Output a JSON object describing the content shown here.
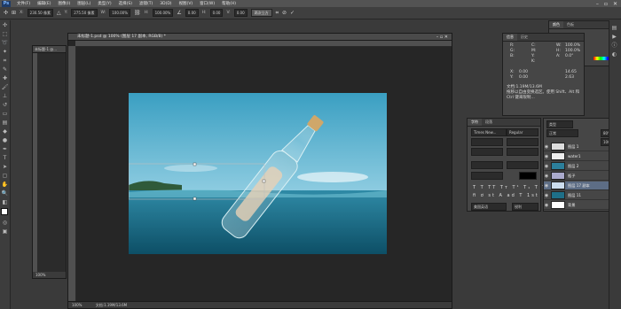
{
  "app": {
    "logo": "Ps"
  },
  "menu": [
    "文件(F)",
    "编辑(E)",
    "图像(I)",
    "图层(L)",
    "类型(Y)",
    "选择(S)",
    "滤镜(T)",
    "3D(D)",
    "视图(V)",
    "窗口(W)",
    "帮助(H)"
  ],
  "window_buttons": [
    "–",
    "▫",
    "✕"
  ],
  "options": {
    "x_label": "X:",
    "x_value": "230.50 像素",
    "y_label": "Y:",
    "y_value": "275.50 像素",
    "w_label": "W:",
    "w_value": "100.00%",
    "h_label": "H:",
    "h_value": "100.00%",
    "angle_value": "0.00",
    "hskew_label": "H:",
    "hskew_value": "0.00",
    "vskew_label": "V:",
    "vskew_value": "0.00",
    "interp": "两次立方"
  },
  "nav_doc": {
    "title": "未标题-1 @...",
    "zoom": "100%"
  },
  "main_doc": {
    "title": "未标题-1.psd @ 100% (图层 17 副本, RGB/8) *",
    "zoom": "100%",
    "status": "文档:1.19M/13.6M"
  },
  "info_panel": {
    "tabs": [
      "信息",
      "历史"
    ],
    "r_label": "R:",
    "g_label": "G:",
    "b_label": "B:",
    "c_label": "C:",
    "m_label": "M:",
    "y_label": "Y:",
    "k_label": "K:",
    "w_label": "W:",
    "h_label": "H:",
    "a_label": "A:",
    "w_value": "100.0%",
    "h_value": "100.0%",
    "a_value": "0.0°",
    "x_label": "X:",
    "y2_label": "Y:",
    "x_value": "0.00",
    "y_value": "0.00",
    "w2_value": "14.65",
    "h2_value": "2.63",
    "doc_size": "文档:1.19M/13.6M",
    "hint": "拖移以自由变换选区。使用 Shift、Alt 和 Ctrl 键来限制…"
  },
  "color_panel": {
    "tabs": [
      "颜色",
      "色板"
    ]
  },
  "char_panel": {
    "tabs": [
      "字符",
      "段落"
    ],
    "font": "Times New...",
    "style": "Regular",
    "lang": "美国英语",
    "aa": "锐利"
  },
  "layers_panel": {
    "kind": "类型",
    "blend": "正常",
    "opacity": "80%",
    "fill": "100%",
    "layers": [
      {
        "name": "图层 1",
        "selected": false
      },
      {
        "name": "water1",
        "selected": false
      },
      {
        "name": "图层 2",
        "selected": false
      },
      {
        "name": "瓶子",
        "selected": false
      },
      {
        "name": "图层 17 副本",
        "selected": true
      },
      {
        "name": "图层 11",
        "selected": false
      },
      {
        "name": "背景",
        "selected": false
      }
    ]
  }
}
